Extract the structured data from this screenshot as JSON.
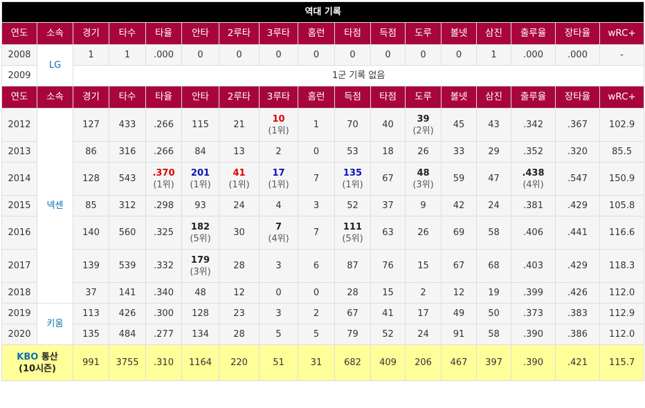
{
  "title": "역대 기록",
  "headers": [
    "연도",
    "소속",
    "경기",
    "타수",
    "타율",
    "안타",
    "2루타",
    "3루타",
    "홈런",
    "타점",
    "득점",
    "도루",
    "볼넷",
    "삼진",
    "출루율",
    "장타율",
    "wRC+"
  ],
  "headers2": [
    "연도",
    "소속",
    "경기",
    "타수",
    "타율",
    "안타",
    "2루타",
    "3루타",
    "홈런",
    "득점",
    "타점",
    "도루",
    "볼넷",
    "삼진",
    "출루율",
    "장타율",
    "wRC+"
  ],
  "teams": {
    "lg": "LG",
    "nexen": "넥센",
    "kiwoom": "키움"
  },
  "no_record": "1군 기록 없음",
  "rows": {
    "y2008": {
      "year": "2008",
      "g": "1",
      "ab": "1",
      "avg": ".000",
      "h": "0",
      "d": "0",
      "t": "0",
      "hr": "0",
      "rbi": "0",
      "r": "0",
      "sb": "0",
      "bb": "0",
      "so": "1",
      "obp": ".000",
      "slg": ".000",
      "wrc": "-"
    },
    "y2009": {
      "year": "2009"
    },
    "y2012": {
      "year": "2012",
      "g": "127",
      "ab": "433",
      "avg": ".266",
      "h": "115",
      "d": "21",
      "t": "10",
      "t_rank": "(1위)",
      "hr": "1",
      "r": "70",
      "rbi": "40",
      "sb": "39",
      "sb_rank": "(2위)",
      "bb": "45",
      "so": "43",
      "obp": ".342",
      "slg": ".367",
      "wrc": "102.9"
    },
    "y2013": {
      "year": "2013",
      "g": "86",
      "ab": "316",
      "avg": ".266",
      "h": "84",
      "d": "13",
      "t": "2",
      "hr": "0",
      "r": "53",
      "rbi": "18",
      "sb": "26",
      "bb": "33",
      "so": "29",
      "obp": ".352",
      "slg": ".320",
      "wrc": "85.5"
    },
    "y2014": {
      "year": "2014",
      "g": "128",
      "ab": "543",
      "avg": ".370",
      "avg_rank": "(1위)",
      "h": "201",
      "h_rank": "(1위)",
      "d": "41",
      "d_rank": "(1위)",
      "t": "17",
      "t_rank": "(1위)",
      "hr": "7",
      "r": "135",
      "r_rank": "(1위)",
      "rbi": "67",
      "sb": "48",
      "sb_rank": "(3위)",
      "bb": "59",
      "so": "47",
      "obp": ".438",
      "obp_rank": "(4위)",
      "slg": ".547",
      "wrc": "150.9"
    },
    "y2015": {
      "year": "2015",
      "g": "85",
      "ab": "312",
      "avg": ".298",
      "h": "93",
      "d": "24",
      "t": "4",
      "hr": "3",
      "r": "52",
      "rbi": "37",
      "sb": "9",
      "bb": "42",
      "so": "24",
      "obp": ".381",
      "slg": ".429",
      "wrc": "105.8"
    },
    "y2016": {
      "year": "2016",
      "g": "140",
      "ab": "560",
      "avg": ".325",
      "h": "182",
      "h_rank": "(5위)",
      "d": "30",
      "t": "7",
      "t_rank": "(4위)",
      "hr": "7",
      "r": "111",
      "r_rank": "(5위)",
      "rbi": "63",
      "sb": "26",
      "bb": "69",
      "so": "58",
      "obp": ".406",
      "slg": ".441",
      "wrc": "116.6"
    },
    "y2017": {
      "year": "2017",
      "g": "139",
      "ab": "539",
      "avg": ".332",
      "h": "179",
      "h_rank": "(3위)",
      "d": "28",
      "t": "3",
      "hr": "6",
      "r": "87",
      "rbi": "76",
      "sb": "15",
      "bb": "67",
      "so": "68",
      "obp": ".403",
      "slg": ".429",
      "wrc": "118.3"
    },
    "y2018": {
      "year": "2018",
      "g": "37",
      "ab": "141",
      "avg": ".340",
      "h": "48",
      "d": "12",
      "t": "0",
      "hr": "0",
      "r": "28",
      "rbi": "15",
      "sb": "2",
      "bb": "12",
      "so": "19",
      "obp": ".399",
      "slg": ".426",
      "wrc": "112.0"
    },
    "y2019": {
      "year": "2019",
      "g": "113",
      "ab": "426",
      "avg": ".300",
      "h": "128",
      "d": "23",
      "t": "3",
      "hr": "2",
      "r": "67",
      "rbi": "41",
      "sb": "17",
      "bb": "49",
      "so": "50",
      "obp": ".373",
      "slg": ".383",
      "wrc": "112.9"
    },
    "y2020": {
      "year": "2020",
      "g": "135",
      "ab": "484",
      "avg": ".277",
      "h": "134",
      "d": "28",
      "t": "5",
      "hr": "5",
      "r": "79",
      "rbi": "52",
      "sb": "24",
      "bb": "91",
      "so": "58",
      "obp": ".390",
      "slg": ".386",
      "wrc": "112.0"
    }
  },
  "total": {
    "label1": "KBO",
    "label2": " 통산",
    "label3": "(10시즌)",
    "g": "991",
    "ab": "3755",
    "avg": ".310",
    "h": "1164",
    "d": "220",
    "t": "51",
    "hr": "31",
    "r": "682",
    "rbi": "409",
    "sb": "206",
    "bb": "467",
    "so": "397",
    "obp": ".390",
    "slg": ".421",
    "wrc": "115.7"
  }
}
